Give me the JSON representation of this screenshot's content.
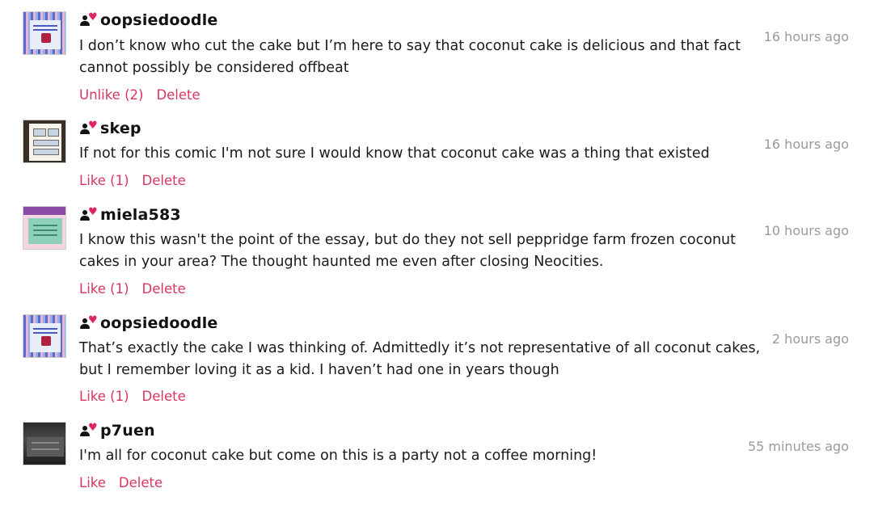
{
  "comments": [
    {
      "username": "oopsiedoodle",
      "text": "I don’t know who cut the cake but I’m here to say that coconut cake is delicious and that fact cannot possibly be considered offbeat",
      "time": "16 hours ago",
      "like_label": "Unlike (2)",
      "delete_label": "Delete"
    },
    {
      "username": "skep",
      "text": "If not for this comic I'm not sure I would know that coconut cake was a thing that existed",
      "time": "16 hours ago",
      "like_label": "Like (1)",
      "delete_label": "Delete"
    },
    {
      "username": "miela583",
      "text": "I know this wasn't the point of the essay, but do they not sell peppridge farm frozen coconut cakes in your area? The thought haunted me even after closing Neocities.",
      "time": "10 hours ago",
      "like_label": "Like (1)",
      "delete_label": "Delete"
    },
    {
      "username": "oopsiedoodle",
      "text": "That’s exactly the cake I was thinking of. Admittedly it’s not representative of all coconut cakes, but I remember loving it as a kid. I haven’t had one in years though",
      "time": "2 hours ago",
      "like_label": "Like (1)",
      "delete_label": "Delete"
    },
    {
      "username": "p7uen",
      "text": "I'm all for coconut cake but come on this is a party not a coffee morning!",
      "time": "55 minutes ago",
      "like_label": "Like",
      "delete_label": "Delete"
    }
  ],
  "icons": {
    "follow": "user-heart-icon"
  },
  "colors": {
    "action": "#d9355f",
    "timestamp": "#9a9a9a",
    "heart": "#e0245e"
  }
}
